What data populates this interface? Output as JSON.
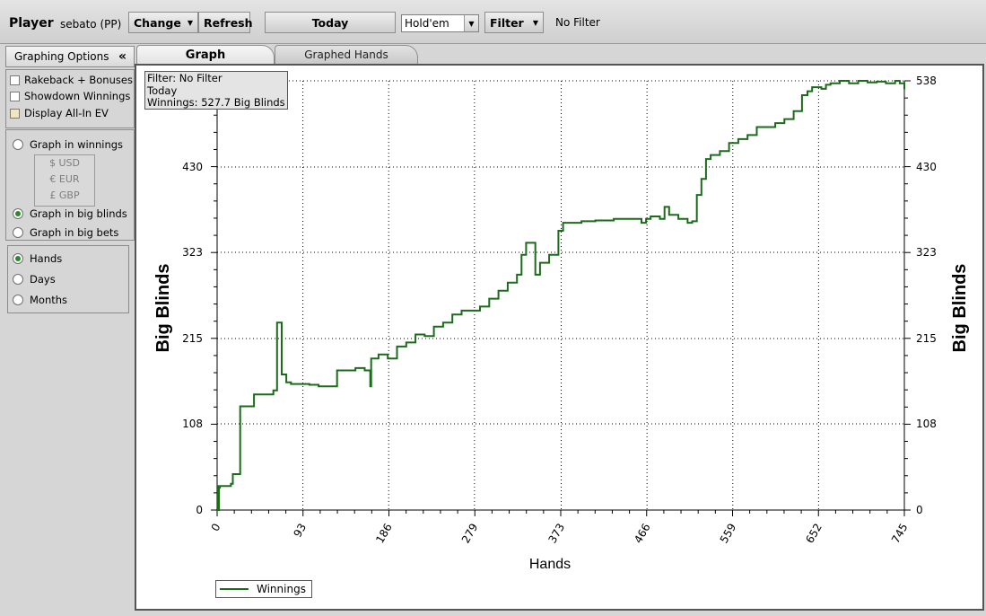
{
  "toolbar": {
    "player_label": "Player",
    "player_name": "sebato (PP)",
    "change_label": "Change",
    "refresh_label": "Refresh",
    "today_label": "Today",
    "game_select_value": "Hold'em",
    "filter_label": "Filter",
    "filter_status": "No Filter"
  },
  "sidebar": {
    "header": "Graphing Options",
    "collapse_glyph": "«",
    "checkboxes": [
      {
        "label": "Rakeback + Bonuses",
        "checked": false
      },
      {
        "label": "Showdown Winnings",
        "checked": false
      },
      {
        "label": "Display All-In EV",
        "checked": false
      }
    ],
    "unit_options": [
      {
        "label": "Graph in winnings",
        "selected": false
      },
      {
        "label": "Graph in big blinds",
        "selected": true
      },
      {
        "label": "Graph in big bets",
        "selected": false
      }
    ],
    "currencies": [
      "$ USD",
      "€ EUR",
      "£ GBP"
    ],
    "period_options": [
      {
        "label": "Hands",
        "selected": true
      },
      {
        "label": "Days",
        "selected": false
      },
      {
        "label": "Months",
        "selected": false
      }
    ]
  },
  "tabs": [
    {
      "label": "Graph",
      "active": true
    },
    {
      "label": "Graphed Hands",
      "active": false
    }
  ],
  "info_box": {
    "line1": "Filter: No Filter",
    "line2": "Today",
    "line3": "Winnings: 527.7 Big Blinds"
  },
  "colors": {
    "series": "#1b6b1b",
    "grid": "#000000"
  },
  "chart_data": {
    "type": "line",
    "xlabel": "Hands",
    "ylabel": "Big Blinds",
    "x_ticks": [
      "0",
      "93",
      "186",
      "279",
      "373",
      "466",
      "559",
      "652",
      "745"
    ],
    "y_ticks": [
      "0",
      "108",
      "215",
      "323",
      "430",
      "538"
    ],
    "xlim": [
      0,
      745
    ],
    "ylim": [
      0,
      538
    ],
    "grid": true,
    "legend": "bottom-left",
    "series": [
      {
        "name": "Winnings",
        "x": [
          0,
          1,
          2,
          3,
          15,
          17,
          23,
          25,
          37,
          40,
          55,
          61,
          65,
          67,
          70,
          75,
          80,
          90,
          100,
          110,
          125,
          130,
          135,
          150,
          160,
          166,
          167,
          175,
          185,
          195,
          205,
          215,
          225,
          235,
          245,
          255,
          265,
          275,
          285,
          295,
          305,
          315,
          325,
          330,
          335,
          340,
          345,
          350,
          360,
          370,
          375,
          385,
          390,
          395,
          400,
          410,
          420,
          430,
          440,
          450,
          460,
          465,
          470,
          480,
          485,
          490,
          500,
          510,
          515,
          520,
          525,
          530,
          535,
          545,
          555,
          565,
          575,
          585,
          595,
          605,
          615,
          625,
          632,
          634,
          640,
          645,
          650,
          655,
          660,
          665,
          675,
          685,
          695,
          705,
          715,
          725,
          735,
          740,
          745
        ],
        "y": [
          30,
          0,
          28,
          30,
          33,
          45,
          45,
          130,
          130,
          145,
          145,
          150,
          235,
          235,
          170,
          160,
          158,
          158,
          157,
          155,
          155,
          175,
          175,
          178,
          175,
          155,
          190,
          195,
          190,
          205,
          210,
          220,
          218,
          230,
          235,
          245,
          250,
          250,
          255,
          265,
          275,
          285,
          295,
          320,
          335,
          335,
          295,
          310,
          320,
          350,
          360,
          360,
          360,
          362,
          362,
          363,
          363,
          365,
          365,
          365,
          360,
          365,
          368,
          365,
          380,
          370,
          365,
          360,
          362,
          395,
          415,
          440,
          445,
          450,
          460,
          465,
          470,
          480,
          480,
          485,
          490,
          500,
          500,
          520,
          525,
          530,
          530,
          528,
          533,
          535,
          538,
          535,
          538,
          536,
          537,
          535,
          538,
          535,
          527.7
        ]
      }
    ]
  }
}
